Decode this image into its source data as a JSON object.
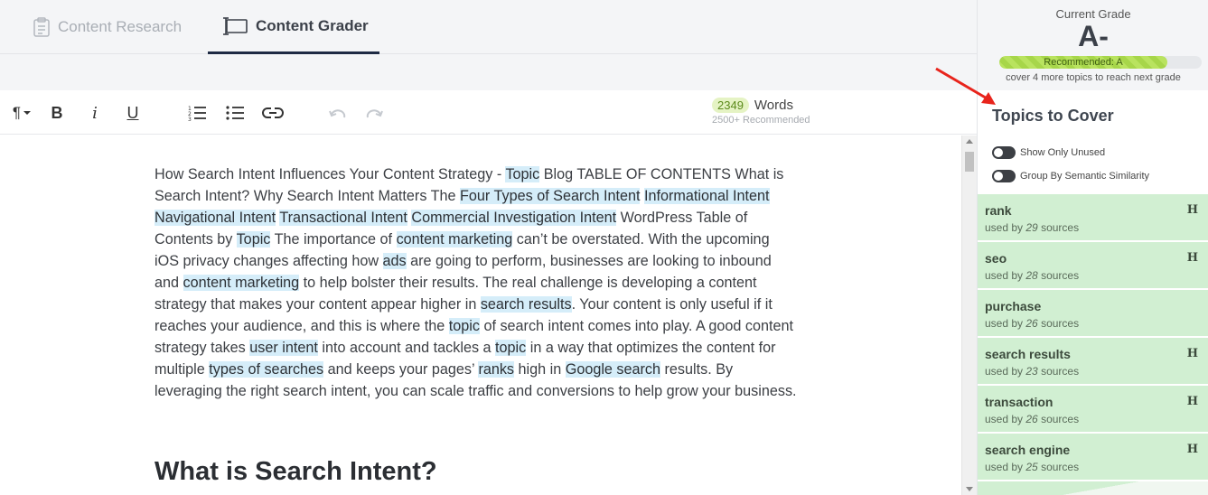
{
  "tabs": {
    "research": "Content Research",
    "grader": "Content Grader"
  },
  "toolbar": {
    "words_count": "2349",
    "words_label": "Words",
    "words_recommended": "2500+ Recommended"
  },
  "editor": {
    "paragraph_segments": [
      {
        "t": "How Search Intent Influences Your Content Strategy - ",
        "h": false
      },
      {
        "t": "Topic",
        "h": true
      },
      {
        "t": " Blog TABLE OF CONTENTS What is Search Intent? Why Search Intent Matters The ",
        "h": false
      },
      {
        "t": "Four Types of Search Intent",
        "h": true
      },
      {
        "t": " ",
        "h": false
      },
      {
        "t": "Informational Intent",
        "h": true
      },
      {
        "t": " ",
        "h": false
      },
      {
        "t": "Navigational Intent",
        "h": true
      },
      {
        "t": " ",
        "h": false
      },
      {
        "t": "Transactional Intent",
        "h": true
      },
      {
        "t": " ",
        "h": false
      },
      {
        "t": "Commercial Investigation Intent",
        "h": true
      },
      {
        "t": " WordPress Table of Contents by ",
        "h": false
      },
      {
        "t": "Topic",
        "h": true
      },
      {
        "t": " The importance of ",
        "h": false
      },
      {
        "t": "content marketing",
        "h": true
      },
      {
        "t": " can’t be overstated. With the upcoming iOS privacy changes affecting how ",
        "h": false
      },
      {
        "t": "ads",
        "h": true
      },
      {
        "t": " are going to perform, businesses are looking to inbound and ",
        "h": false
      },
      {
        "t": "content marketing",
        "h": true
      },
      {
        "t": " to help bolster their results. The real challenge is developing a content strategy that makes your content appear higher in ",
        "h": false
      },
      {
        "t": "search results",
        "h": true
      },
      {
        "t": ". Your content is only useful if it reaches your audience, and this is where the ",
        "h": false
      },
      {
        "t": "topic",
        "h": true
      },
      {
        "t": " of search intent comes into play. A good content strategy takes ",
        "h": false
      },
      {
        "t": "user intent",
        "h": true
      },
      {
        "t": " into account and tackles a ",
        "h": false
      },
      {
        "t": "topic",
        "h": true
      },
      {
        "t": " in a way that optimizes the content for multiple ",
        "h": false
      },
      {
        "t": "types of searches",
        "h": true
      },
      {
        "t": " and keeps your pages’ ",
        "h": false
      },
      {
        "t": "ranks",
        "h": true
      },
      {
        "t": " high in ",
        "h": false
      },
      {
        "t": "Google search",
        "h": true
      },
      {
        "t": " results. By leveraging the right search intent, you can scale traffic and conversions to help grow your business.",
        "h": false
      }
    ],
    "heading": "What is Search Intent?"
  },
  "grade": {
    "label": "Current Grade",
    "value": "A-",
    "recommended": "Recommended: A",
    "progress": 0.83,
    "note": "cover 4 more topics to reach next grade"
  },
  "topics": {
    "title": "Topics to Cover",
    "toggle_unused": "Show Only Unused",
    "toggle_semantic": "Group By Semantic Similarity",
    "used_prefix": "used by",
    "used_suffix": "sources",
    "items": [
      {
        "name": "rank",
        "count": "29",
        "h": "H"
      },
      {
        "name": "seo",
        "count": "28",
        "h": "H"
      },
      {
        "name": "purchase",
        "count": "26",
        "h": ""
      },
      {
        "name": "search results",
        "count": "23",
        "h": "H"
      },
      {
        "name": "transaction",
        "count": "26",
        "h": "H"
      },
      {
        "name": "search engine",
        "count": "25",
        "h": "H"
      }
    ]
  },
  "colors": {
    "accent_navy": "#1e2a44",
    "highlight": "#d5edf9",
    "topic_green": "#d1efd2",
    "annotation_arrow": "#e8241c"
  }
}
